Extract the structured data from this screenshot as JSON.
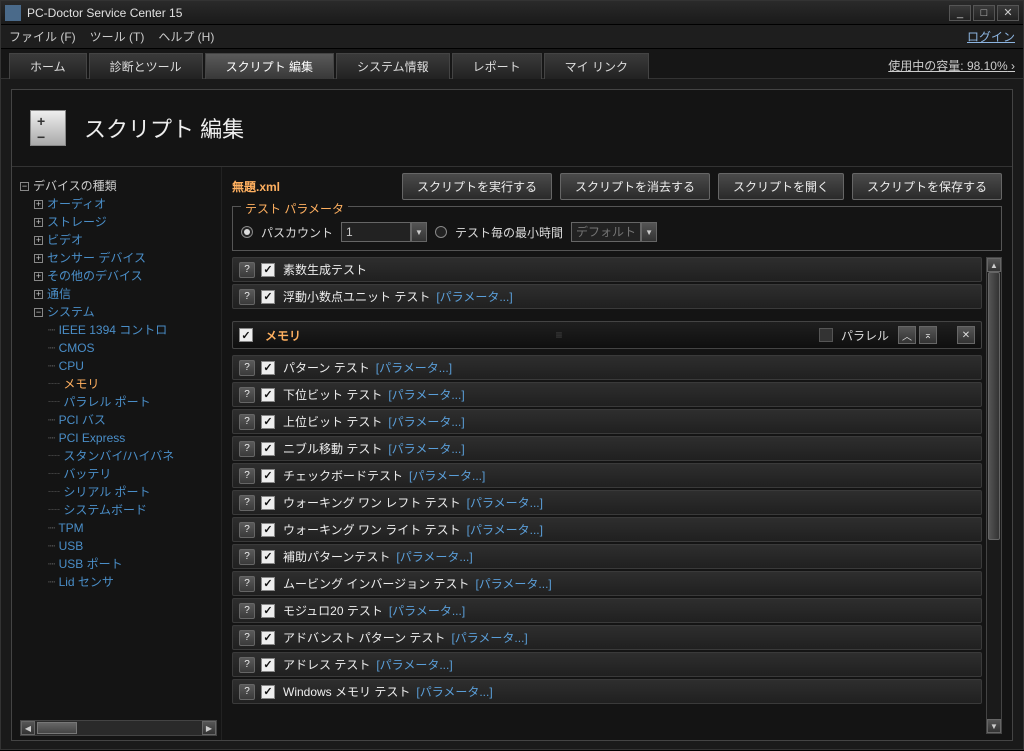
{
  "titlebar": {
    "title": "PC-Doctor Service Center 15"
  },
  "menubar": {
    "file": "ファイル (F)",
    "tool": "ツール (T)",
    "help": "ヘルプ (H)",
    "login": "ログイン"
  },
  "tabs": {
    "home": "ホーム",
    "diagnostics": "診断とツール",
    "script": "スクリプト 編集",
    "sysinfo": "システム情報",
    "report": "レポート",
    "mylinks": "マイ リンク"
  },
  "capacity_label": "使用中の容量: 98.10%",
  "page_title": "スクリプト 編集",
  "tree": {
    "root": "デバイスの種類",
    "nodes": [
      "オーディオ",
      "ストレージ",
      "ビデオ",
      "センサー デバイス",
      "その他のデバイス",
      "通信"
    ],
    "system": "システム",
    "system_children": [
      "IEEE 1394 コントロ",
      "CMOS",
      "CPU",
      "メモリ",
      "パラレル ポート",
      "PCI バス",
      "PCI Express",
      "スタンバイ/ハイバネ",
      "バッテリ",
      "シリアル ポート",
      "システムボード",
      "TPM",
      "USB",
      "USB ポート",
      "Lid センサ"
    ]
  },
  "selected_leaf": "メモリ",
  "filename": "無題.xml",
  "buttons": {
    "run": "スクリプトを実行する",
    "clear": "スクリプトを消去する",
    "open": "スクリプトを開く",
    "save": "スクリプトを保存する"
  },
  "params": {
    "legend": "テスト パラメータ",
    "pass_count": "パスカウント",
    "pass_value": "1",
    "min_time": "テスト毎の最小時間",
    "min_placeholder": "デフォルト"
  },
  "pre_tests": [
    {
      "name": "素数生成テスト",
      "param": ""
    },
    {
      "name": "浮動小数点ユニット テスト",
      "param": "[パラメータ...]"
    }
  ],
  "group": {
    "name": "メモリ",
    "parallel": "パラレル"
  },
  "tests": [
    {
      "name": "パターン テスト",
      "param": "[パラメータ...]"
    },
    {
      "name": "下位ビット テスト",
      "param": "[パラメータ...]"
    },
    {
      "name": "上位ビット テスト",
      "param": "[パラメータ...]"
    },
    {
      "name": "ニブル移動 テスト",
      "param": "[パラメータ...]"
    },
    {
      "name": "チェックボードテスト",
      "param": "[パラメータ...]"
    },
    {
      "name": "ウォーキング ワン レフト テスト",
      "param": "[パラメータ...]"
    },
    {
      "name": "ウォーキング ワン ライト テスト",
      "param": "[パラメータ...]"
    },
    {
      "name": "補助パターンテスト",
      "param": "[パラメータ...]"
    },
    {
      "name": "ムービング インバージョン テスト",
      "param": "[パラメータ...]"
    },
    {
      "name": "モジュロ20 テスト",
      "param": "[パラメータ...]"
    },
    {
      "name": "アドバンスト パターン テスト",
      "param": "[パラメータ...]"
    },
    {
      "name": "アドレス テスト",
      "param": "[パラメータ...]"
    },
    {
      "name": "Windows メモリ テスト",
      "param": "[パラメータ...]"
    }
  ]
}
